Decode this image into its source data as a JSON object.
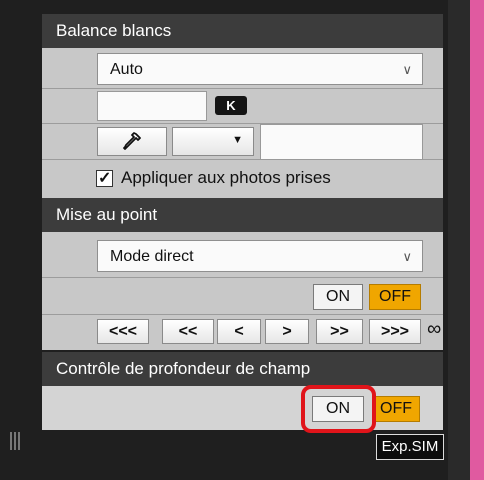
{
  "white_balance": {
    "header": "Balance blancs",
    "mode_value": "Auto",
    "kelvin_badge": "K",
    "kelvin_value": "",
    "dropper_icon": "eyedropper-icon",
    "preset_arrow": "▼",
    "apply_label": "Appliquer aux photos prises",
    "apply_checked": "✓"
  },
  "focus": {
    "header": "Mise au point",
    "mode_value": "Mode direct",
    "on_label": "ON",
    "off_label": "OFF",
    "steps": [
      "<<<",
      "<<",
      "<",
      ">",
      ">>",
      ">>>"
    ],
    "infinity": "∞"
  },
  "dof": {
    "header": "Contrôle de profondeur de champ",
    "on_label": "ON",
    "off_label": "OFF"
  },
  "exp_sim_label": "Exp.SIM",
  "colors": {
    "accent_off": "#f0a600",
    "highlight_ring": "#e0141a",
    "side_strip": "#e05aa0"
  }
}
